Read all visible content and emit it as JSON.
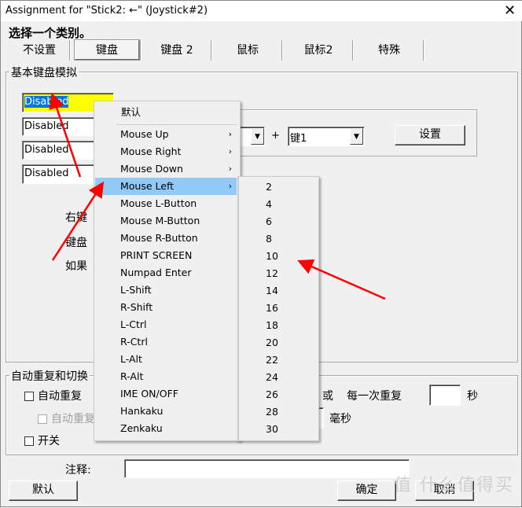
{
  "window": {
    "title": "Assignment for \"Stick2: ←\" (Joystick#2)",
    "close_icon": "close-icon"
  },
  "heading": "选择一个类别。",
  "tabs": [
    {
      "label": "不设置"
    },
    {
      "label": "键盘",
      "selected": true
    },
    {
      "label": "键盘 2"
    },
    {
      "label": "鼠标"
    },
    {
      "label": "鼠标2"
    },
    {
      "label": "特殊"
    }
  ],
  "basic_group": {
    "label": "基本键盘模拟",
    "fields": [
      {
        "value": "Disabled",
        "highlighted": true
      },
      {
        "value": "Disabled"
      },
      {
        "value": "Disabled"
      },
      {
        "value": "Disabled"
      }
    ],
    "plus": "+",
    "combo2_value": "键1",
    "set_button": "设置",
    "texts": [
      "右键",
      "键盘",
      "如果"
    ]
  },
  "context_menu": {
    "default_label": "默认",
    "items": [
      {
        "label": "Mouse Up",
        "submenu": true
      },
      {
        "label": "Mouse Right",
        "submenu": true
      },
      {
        "label": "Mouse Down",
        "submenu": true
      },
      {
        "label": "Mouse Left",
        "submenu": true,
        "highlighted": true
      },
      {
        "label": "Mouse L-Button"
      },
      {
        "label": "Mouse M-Button"
      },
      {
        "label": "Mouse R-Button"
      },
      {
        "label": "PRINT SCREEN"
      },
      {
        "label": "Numpad Enter"
      },
      {
        "label": "L-Shift"
      },
      {
        "label": "R-Shift"
      },
      {
        "label": "L-Ctrl"
      },
      {
        "label": "R-Ctrl"
      },
      {
        "label": "L-Alt"
      },
      {
        "label": "R-Alt"
      },
      {
        "label": "IME ON/OFF"
      },
      {
        "label": "Hankaku"
      },
      {
        "label": "Zenkaku"
      }
    ],
    "submenu": [
      "2",
      "4",
      "6",
      "8",
      "10",
      "12",
      "14",
      "16",
      "18",
      "20",
      "22",
      "24",
      "26",
      "28",
      "30"
    ]
  },
  "repeat_group": {
    "label": "自动重复和切换",
    "auto_repeat": "自动重复",
    "auto_repeat2": "自动重复",
    "toggle": "开关",
    "or": "或",
    "every_repeat": "每一次重复",
    "seconds": "秒",
    "ms": "毫秒"
  },
  "comment": {
    "label": "注释:",
    "value": ""
  },
  "buttons": {
    "default": "默认",
    "ok": "确定",
    "cancel": "取消"
  },
  "watermark": "值 什么值得买",
  "colors": {
    "highlight_field": "#ffff00",
    "selection": "#0078d7",
    "menu_highlight": "#91c9f7",
    "arrow": "#ff0000"
  }
}
